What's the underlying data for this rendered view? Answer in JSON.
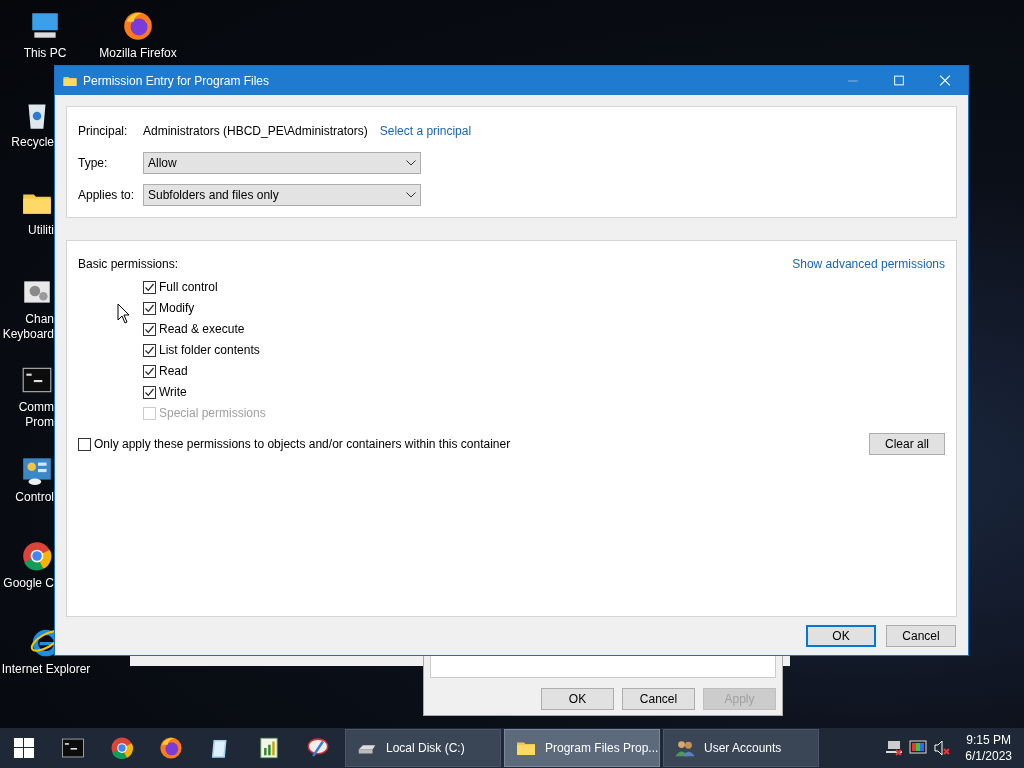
{
  "desktop_icons": [
    {
      "kind": "computer",
      "lines": [
        "This PC"
      ]
    },
    {
      "kind": "firefox",
      "lines": [
        "Mozilla Firefox"
      ]
    },
    {
      "kind": "recycle",
      "lines": [
        "Recycle"
      ]
    },
    {
      "kind": "folder",
      "lines": [
        "Utiliti"
      ]
    },
    {
      "kind": "gear",
      "lines": [
        "Chan",
        "Keyboard"
      ]
    },
    {
      "kind": "cmd",
      "lines": [
        "Comm",
        "Prom"
      ]
    },
    {
      "kind": "control",
      "lines": [
        "Control"
      ]
    },
    {
      "kind": "chrome",
      "lines": [
        "Google C"
      ]
    },
    {
      "kind": "ie",
      "lines": [
        "Internet Explorer"
      ]
    }
  ],
  "background_dialog": {
    "buttons": [
      {
        "label": "OK",
        "disabled": false
      },
      {
        "label": "Cancel",
        "disabled": false
      },
      {
        "label": "Apply",
        "disabled": true
      }
    ]
  },
  "window": {
    "title": "Permission Entry for Program Files",
    "principal": {
      "label": "Principal:",
      "value": "Administrators (HBCD_PE\\Administrators)",
      "link": "Select a principal"
    },
    "type": {
      "label": "Type:",
      "value": "Allow"
    },
    "applies_to": {
      "label": "Applies to:",
      "value": "Subfolders and files only"
    },
    "basic_permissions": {
      "label": "Basic permissions:",
      "link": "Show advanced permissions",
      "items": [
        {
          "label": "Full control",
          "checked": true,
          "disabled": false
        },
        {
          "label": "Modify",
          "checked": true,
          "disabled": false
        },
        {
          "label": "Read & execute",
          "checked": true,
          "disabled": false
        },
        {
          "label": "List folder contents",
          "checked": true,
          "disabled": false
        },
        {
          "label": "Read",
          "checked": true,
          "disabled": false
        },
        {
          "label": "Write",
          "checked": true,
          "disabled": false
        },
        {
          "label": "Special permissions",
          "checked": false,
          "disabled": true
        }
      ]
    },
    "only_apply": {
      "label": "Only apply these permissions to objects and/or containers within this container",
      "checked": false
    },
    "clear_button": "Clear all",
    "buttons": [
      {
        "label": "OK",
        "default": true
      },
      {
        "label": "Cancel",
        "default": false
      }
    ]
  },
  "taskbar": {
    "pinned": [
      {
        "kind": "cmd"
      },
      {
        "kind": "chrome"
      },
      {
        "kind": "firefox"
      },
      {
        "kind": "notepad"
      },
      {
        "kind": "chart"
      },
      {
        "kind": "tool"
      }
    ],
    "tasks": [
      {
        "kind": "drive",
        "label": "Local Disk (C:)",
        "selected": false
      },
      {
        "kind": "folder",
        "label": "Program Files Prop...",
        "selected": true
      },
      {
        "kind": "users",
        "label": "User Accounts",
        "selected": false
      }
    ],
    "tray": [
      {
        "kind": "network"
      },
      {
        "kind": "display"
      },
      {
        "kind": "volume"
      }
    ],
    "time": "9:15 PM",
    "date": "6/1/2023"
  }
}
